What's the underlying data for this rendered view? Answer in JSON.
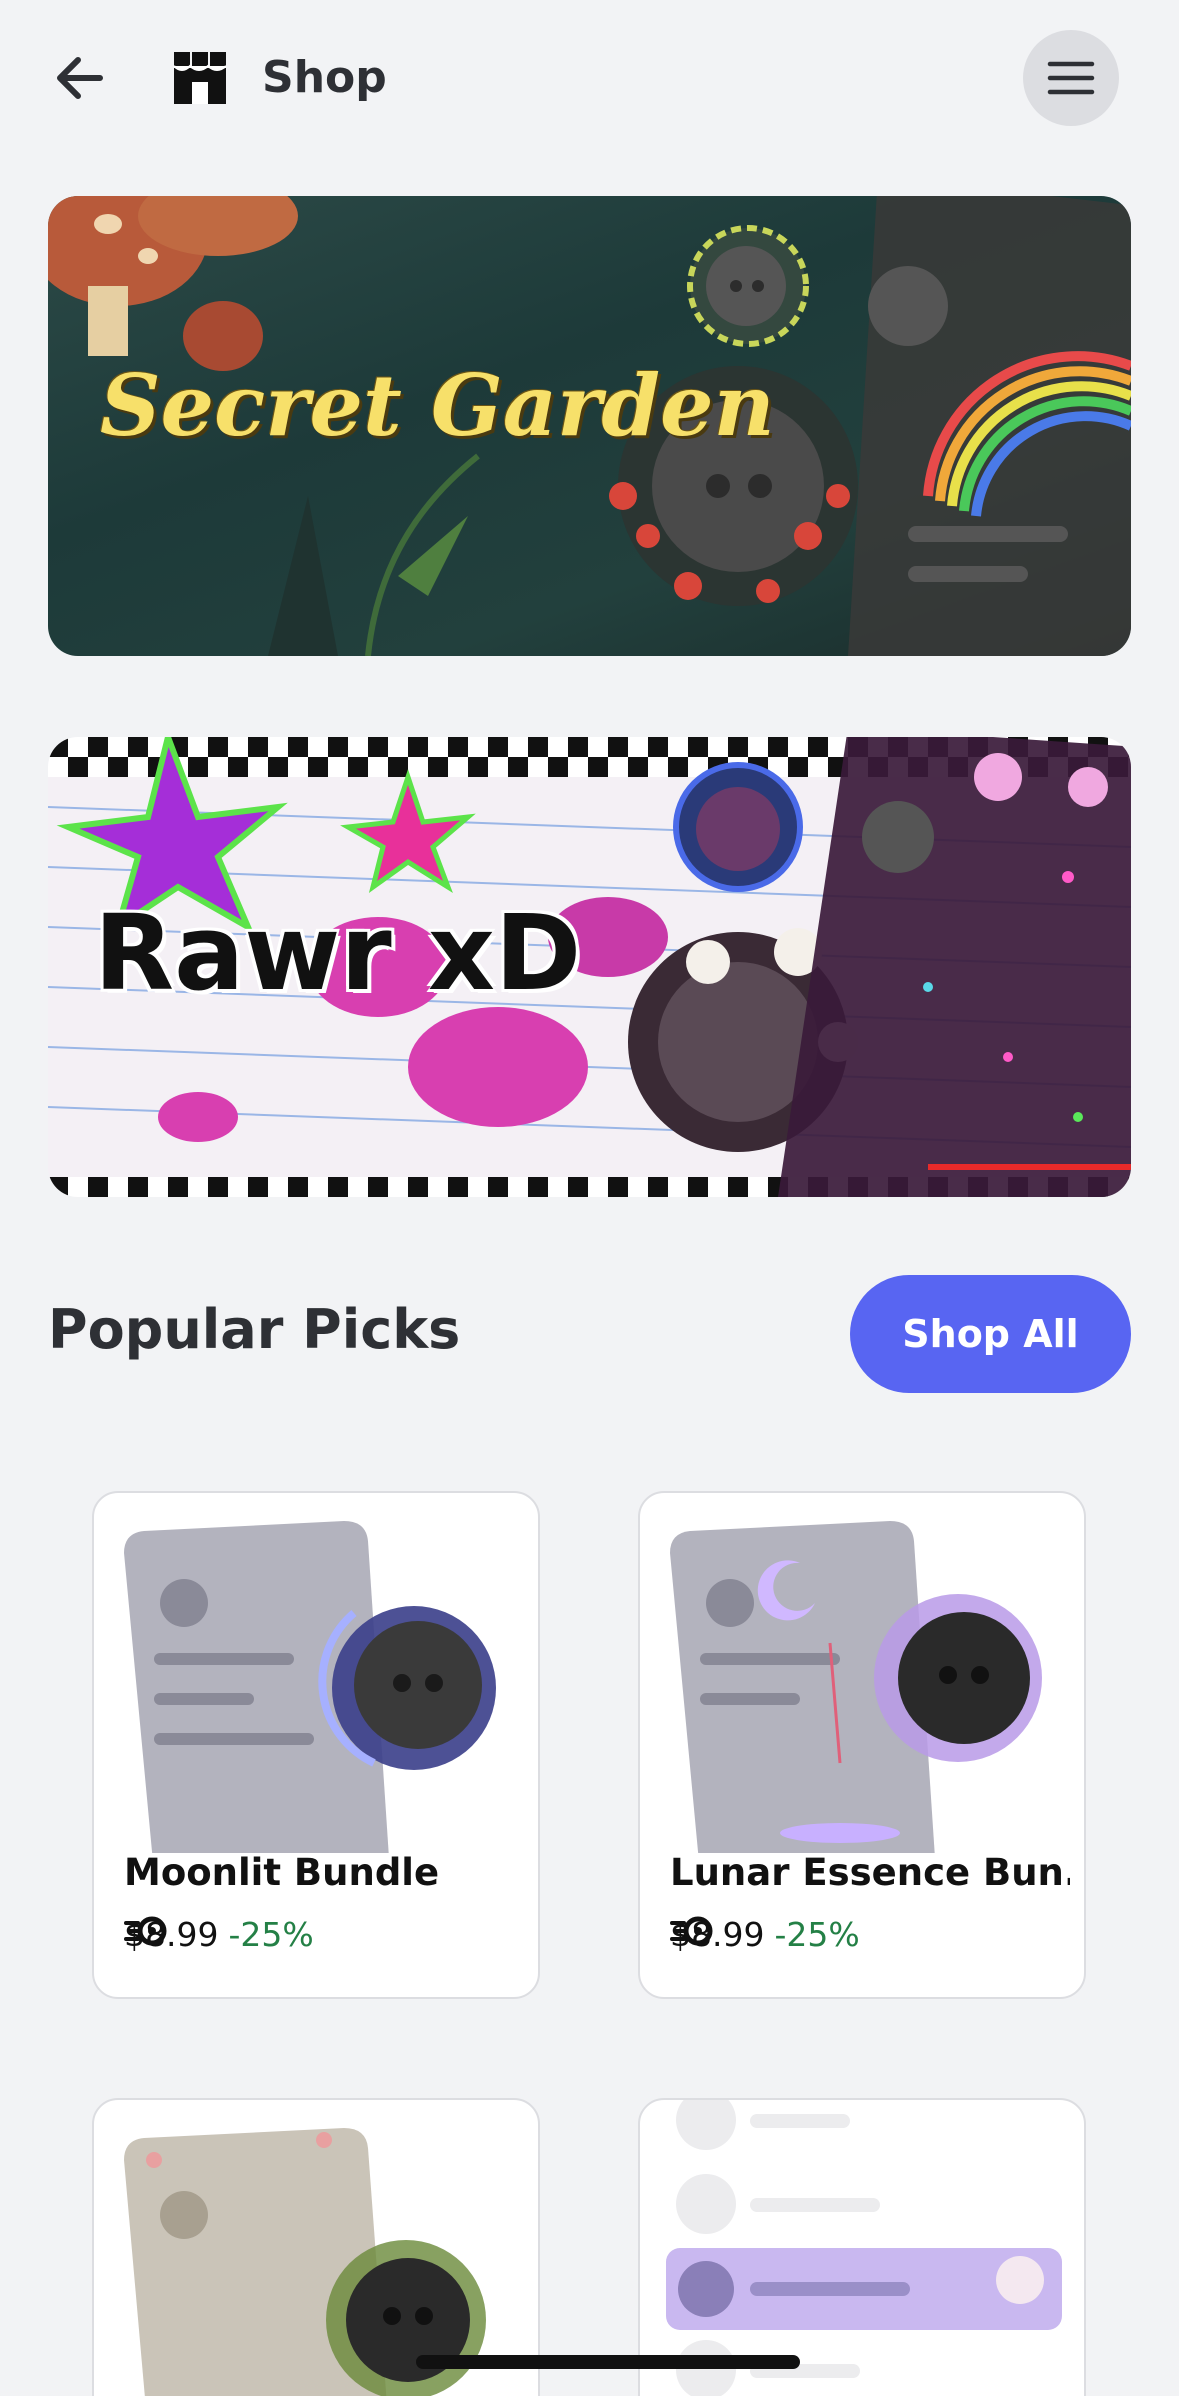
{
  "header": {
    "title": "Shop",
    "back_icon": "arrow-left-icon",
    "shop_icon": "shop-icon",
    "menu_icon": "hamburger-menu-icon"
  },
  "banners": [
    {
      "title": "Secret Garden"
    },
    {
      "title": "Rawr xD"
    }
  ],
  "popular": {
    "title": "Popular Picks",
    "shop_all_label": "Shop All"
  },
  "cards": [
    {
      "name": "Moonlit Bundle",
      "price": "$8.99",
      "discount": "-25%"
    },
    {
      "name": "Lunar Essence Bun...",
      "price": "$8.99",
      "discount": "-25%"
    }
  ],
  "colors": {
    "accent": "#5865f2",
    "discount": "#248046",
    "background": "#f2f3f5"
  }
}
